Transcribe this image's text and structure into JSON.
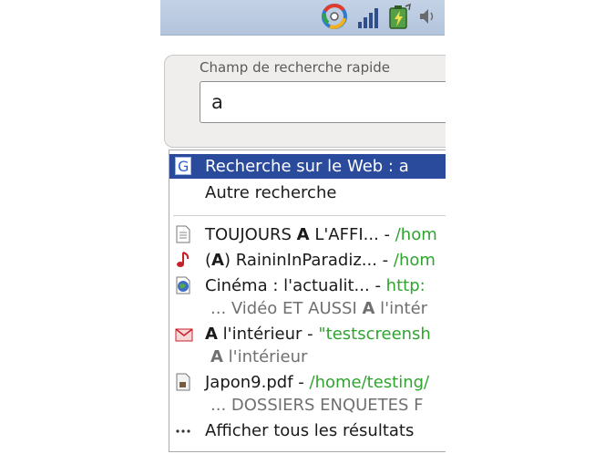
{
  "panel": {
    "icons": [
      "beagle-search-icon",
      "signal-strength-icon",
      "battery-icon",
      "volume-icon"
    ]
  },
  "search": {
    "label": "Champ de recherche rapide",
    "value": "a"
  },
  "dropdown": {
    "web_search": "Recherche sur le Web : a",
    "other_search": "Autre recherche",
    "results": [
      {
        "icon": "document-icon",
        "pre": "TOUJOURS ",
        "bold": "A",
        "post": " L'AFFI... - ",
        "path": "/hom"
      },
      {
        "icon": "music-note-icon",
        "pre": "(",
        "bold": "A",
        "post": ") RaininInParadiz... - ",
        "path": "/hom"
      },
      {
        "icon": "web-page-icon",
        "pre": "Cinéma : l'actualit... - ",
        "bold": "",
        "post": "",
        "path": "http:",
        "snippet_pre": "... Vidéo ET AUSSI ",
        "snippet_bold": "A",
        "snippet_post": " l'intér"
      },
      {
        "icon": "mail-icon",
        "pre": "",
        "bold": "A",
        "post": " l'intérieur - ",
        "path": "\"testscreensh",
        "snippet_pre": "",
        "snippet_bold": "A",
        "snippet_post": " l'intérieur"
      },
      {
        "icon": "pdf-icon",
        "pre": "Japon9.pdf - ",
        "bold": "",
        "post": "",
        "path": "/home/testing/",
        "snippet_pre": "... DOSSIERS ENQUETES F",
        "snippet_bold": "",
        "snippet_post": ""
      }
    ],
    "show_all": "Afficher tous les résultats"
  },
  "colors": {
    "selection": "#2a4a9b",
    "path_green": "#2fa52f",
    "panel": "#b8c8df"
  }
}
